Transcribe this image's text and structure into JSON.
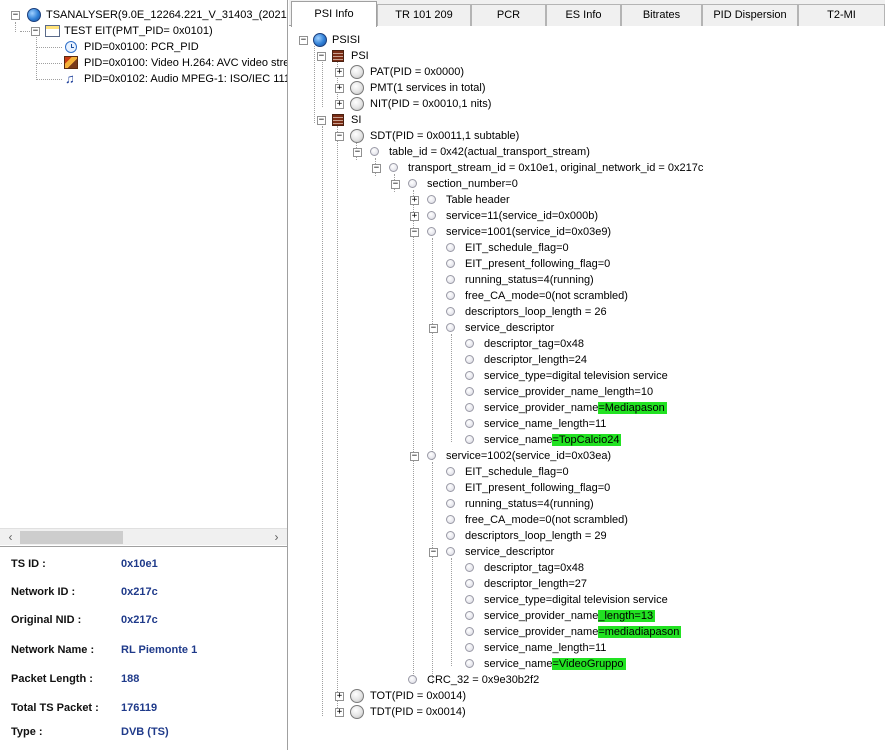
{
  "left_tree": {
    "root": "TSANALYSER(9.0E_12264.221_V_31403_(2021-1",
    "program": "TEST EIT(PMT_PID= 0x0101)",
    "streams": [
      {
        "label": "PID=0x0100: PCR_PID",
        "icon": "clock-icon"
      },
      {
        "label": "PID=0x0100: Video H.264: AVC video stre",
        "icon": "video-icon"
      },
      {
        "label": "PID=0x0102: Audio MPEG-1: ISO/IEC 111",
        "icon": "music-note-icon"
      }
    ]
  },
  "info_panel": [
    {
      "label": "TS ID :",
      "value": "0x10e1"
    },
    {
      "label": "Network ID :",
      "value": "0x217c"
    },
    {
      "label": "Original NID :",
      "value": "0x217c"
    },
    {
      "label": "Network Name :",
      "value": "RL Piemonte 1"
    },
    {
      "label": "Packet Length :",
      "value": "188"
    },
    {
      "label": "Total TS Packet :",
      "value": "176119"
    },
    {
      "label": "Type :",
      "value": "DVB (TS)"
    }
  ],
  "tabs": [
    "PSI Info",
    "TR 101 209",
    "PCR",
    "ES Info",
    "Bitrates",
    "PID Dispersion",
    "T2-MI"
  ],
  "active_tab": "PSI Info",
  "psi_tree": {
    "root": "PSISI",
    "psi": "PSI",
    "pat": "PAT(PID = 0x0000)",
    "pmt": "PMT(1 services in total)",
    "nit": "NIT(PID = 0x0010,1 nits)",
    "si": "SI",
    "sdt": "SDT(PID = 0x0011,1 subtable)",
    "table_id": "table_id = 0x42(actual_transport_stream)",
    "transport": "transport_stream_id = 0x10e1, original_network_id = 0x217c",
    "section": "section_number=0",
    "table_header": "Table header",
    "service11": "service=11(service_id=0x000b)",
    "service1001": {
      "label": "service=1001(service_id=0x03e9)",
      "fields": [
        "EIT_schedule_flag=0",
        "EIT_present_following_flag=0",
        "running_status=4(running)",
        "free_CA_mode=0(not scrambled)",
        "descriptors_loop_length = 26"
      ],
      "descriptor": "service_descriptor",
      "desc_fields": [
        "descriptor_tag=0x48",
        "descriptor_length=24",
        "service_type=digital television service",
        "service_provider_name_length=10"
      ],
      "provider_prefix": "service_provider_name",
      "provider_value": "=Mediapason",
      "name_length": "service_name_length=11",
      "name_prefix": "service_name",
      "name_value": "=TopCalcio24"
    },
    "service1002": {
      "label": "service=1002(service_id=0x03ea)",
      "fields": [
        "EIT_schedule_flag=0",
        "EIT_present_following_flag=0",
        "running_status=4(running)",
        "free_CA_mode=0(not scrambled)",
        "descriptors_loop_length = 29"
      ],
      "descriptor": "service_descriptor",
      "desc_fields": [
        "descriptor_tag=0x48",
        "descriptor_length=27",
        "service_type=digital television service"
      ],
      "provider_len_prefix": "service_provider_name",
      "provider_len_value": "_length=13",
      "provider_prefix": "service_provider_name",
      "provider_value": "=mediadiapason",
      "name_length": "service_name_length=11",
      "name_prefix": "service_name",
      "name_value": "=VideoGruppo"
    },
    "crc": "CRC_32 = 0x9e30b2f2",
    "tot": "TOT(PID = 0x0014)",
    "tdt": "TDT(PID = 0x0014)"
  },
  "colors": {
    "highlight": "#22e222",
    "info_value": "#1f3a8a"
  }
}
